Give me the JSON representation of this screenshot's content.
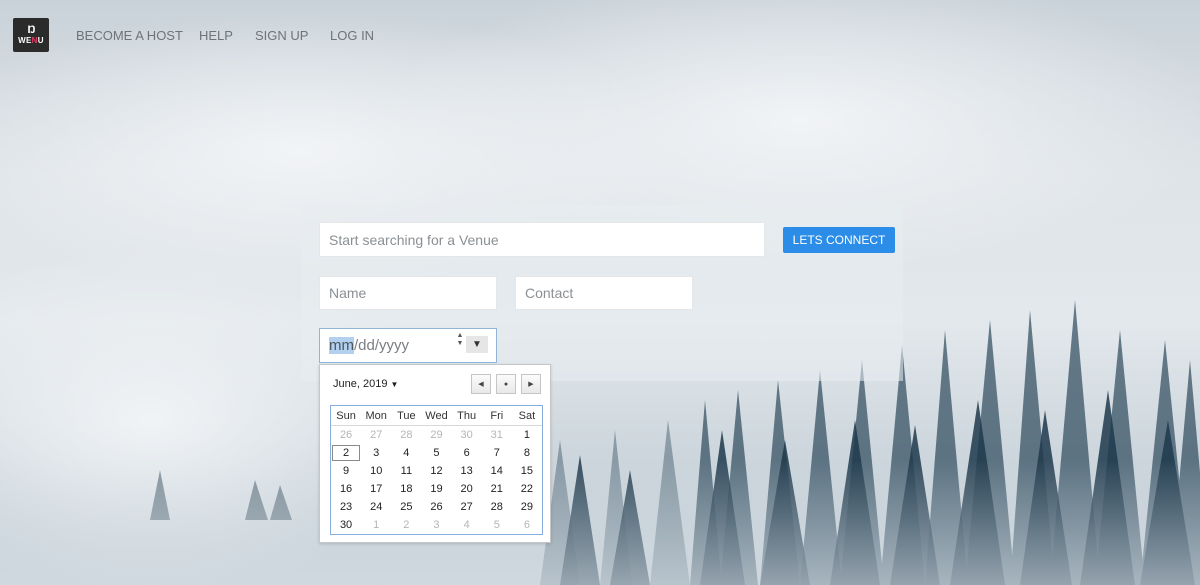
{
  "nav": {
    "logo_glyph": "Ŋ",
    "logo_text_pre": "WE",
    "logo_text_accent": "N",
    "logo_text_post": "U",
    "links": [
      "BECOME A HOST",
      "HELP",
      "SIGN UP",
      "LOG IN"
    ]
  },
  "search": {
    "venue_placeholder": "Start searching for a Venue",
    "connect_label": "LETS CONNECT",
    "name_placeholder": "Name",
    "contact_placeholder": "Contact",
    "date_mm": "mm",
    "date_rest": "/dd/yyyy"
  },
  "calendar": {
    "month_label": "June, 2019",
    "weekdays": [
      "Sun",
      "Mon",
      "Tue",
      "Wed",
      "Thu",
      "Fri",
      "Sat"
    ],
    "weeks": [
      [
        "26",
        "27",
        "28",
        "29",
        "30",
        "31",
        "1"
      ],
      [
        "2",
        "3",
        "4",
        "5",
        "6",
        "7",
        "8"
      ],
      [
        "9",
        "10",
        "11",
        "12",
        "13",
        "14",
        "15"
      ],
      [
        "16",
        "17",
        "18",
        "19",
        "20",
        "21",
        "22"
      ],
      [
        "23",
        "24",
        "25",
        "26",
        "27",
        "28",
        "29"
      ],
      [
        "30",
        "1",
        "2",
        "3",
        "4",
        "5",
        "6"
      ]
    ]
  },
  "colors": {
    "accent": "#2b8de8",
    "logo_accent": "#e8396a"
  },
  "icons": {
    "prev": "left-triangle",
    "today": "dot",
    "next": "right-triangle",
    "dropdown": "down-triangle"
  }
}
